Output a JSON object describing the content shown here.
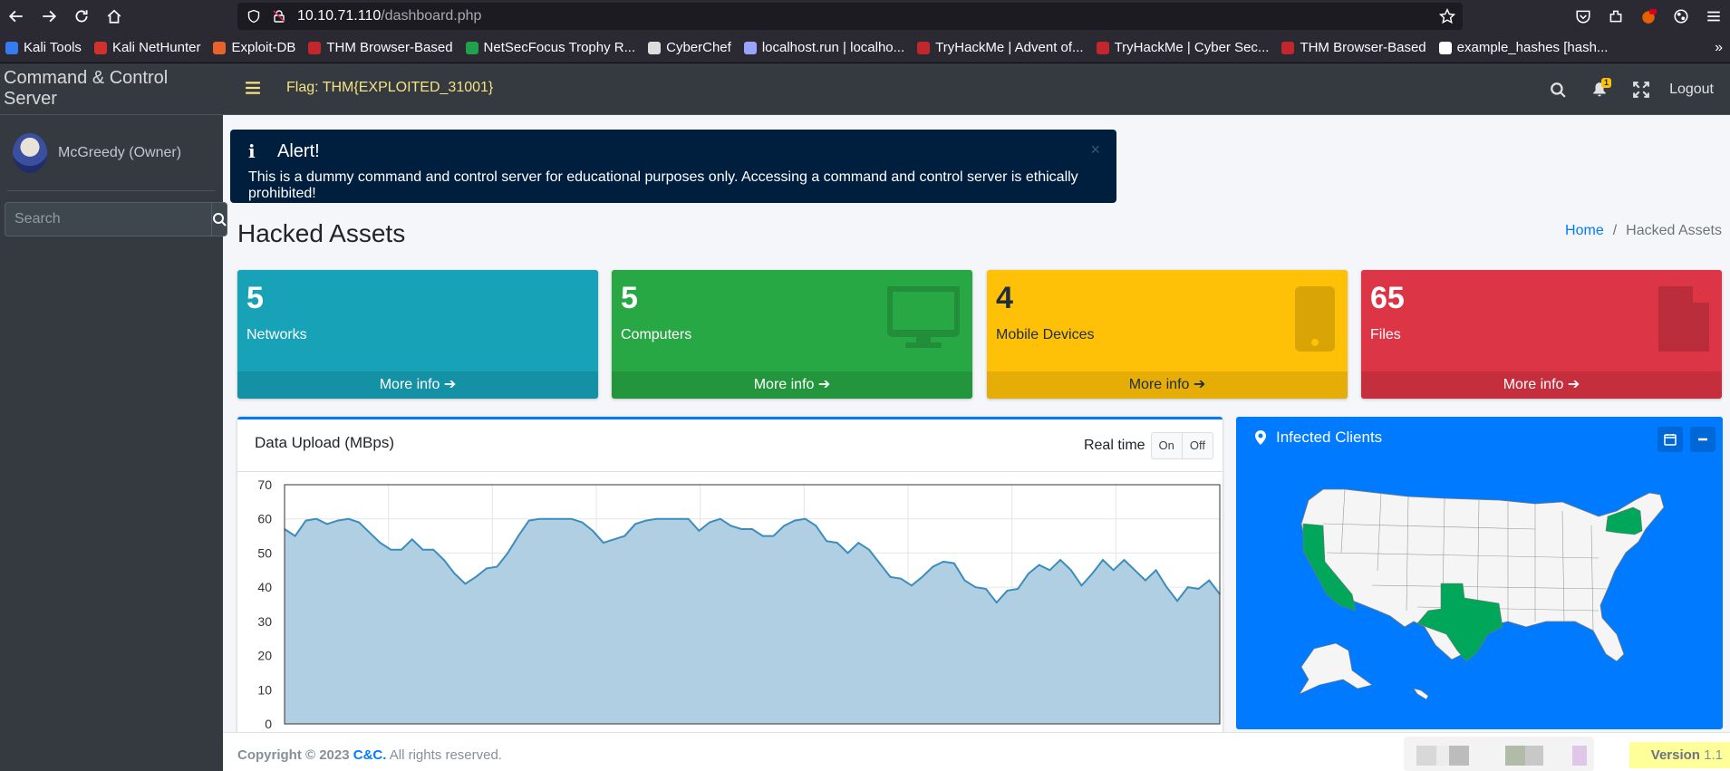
{
  "browser": {
    "url_host": "10.10.71.110",
    "url_path": "/dashboard.php",
    "bookmarks": [
      {
        "label": "Kali Tools",
        "color": "#367bf0"
      },
      {
        "label": "Kali NetHunter",
        "color": "#d0312d"
      },
      {
        "label": "Exploit-DB",
        "color": "#e8622c"
      },
      {
        "label": "THM Browser-Based",
        "color": "#c1272d"
      },
      {
        "label": "NetSecFocus Trophy R...",
        "color": "#22a04b"
      },
      {
        "label": "CyberChef",
        "color": "#dddddd"
      },
      {
        "label": "localhost.run | localho...",
        "color": "#9aa4ff"
      },
      {
        "label": "TryHackMe | Advent of...",
        "color": "#c1272d"
      },
      {
        "label": "TryHackMe | Cyber Sec...",
        "color": "#c1272d"
      },
      {
        "label": "THM Browser-Based",
        "color": "#c1272d"
      },
      {
        "label": "example_hashes [hash...",
        "color": "#ffffff"
      }
    ]
  },
  "sidebar": {
    "brand": "Command & Control Server",
    "user": "McGreedy (Owner)",
    "search_placeholder": "Search"
  },
  "navbar": {
    "flag": "Flag: THM{EXPLOITED_31001}",
    "notification_count": "1",
    "logout": "Logout"
  },
  "alert": {
    "title": "Alert!",
    "message": "This is a dummy command and control server for educational purposes only. Accessing a command and control server is ethically prohibited!"
  },
  "page": {
    "title": "Hacked Assets",
    "breadcrumb_home": "Home",
    "breadcrumb_current": "Hacked Assets"
  },
  "stats": [
    {
      "value": "5",
      "label": "Networks",
      "more": "More info"
    },
    {
      "value": "5",
      "label": "Computers",
      "more": "More info"
    },
    {
      "value": "4",
      "label": "Mobile Devices",
      "more": "More info"
    },
    {
      "value": "65",
      "label": "Files",
      "more": "More info"
    }
  ],
  "upload_card": {
    "title": "Data Upload (MBps)",
    "realtime_label": "Real time",
    "on_label": "On",
    "off_label": "Off"
  },
  "map_card": {
    "title": "Infected Clients"
  },
  "footer": {
    "copyright_prefix": "Copyright © 2023 ",
    "brand": "C&C.",
    "rights": " All rights reserved.",
    "version_label": "Version",
    "version_value": " 1.1"
  },
  "chart_data": {
    "type": "area",
    "title": "",
    "ylim": [
      0,
      70
    ],
    "yticks": [
      0,
      10,
      20,
      30,
      40,
      50,
      60,
      70
    ],
    "grid": true,
    "color": "#3c8dbc",
    "fill": "#b0cfe3",
    "values": [
      57,
      55,
      59.5,
      60,
      58.5,
      59.5,
      60,
      59,
      56,
      53,
      51,
      51,
      54,
      51,
      51,
      48,
      44,
      41,
      43,
      45.5,
      46,
      50,
      55,
      59.5,
      60,
      60,
      60,
      60,
      59,
      56.5,
      53,
      54,
      55,
      58.5,
      59.5,
      60,
      60,
      60,
      60,
      56.5,
      59,
      60,
      58,
      57,
      57,
      55,
      55,
      58,
      59.5,
      60,
      58,
      53.5,
      53,
      50,
      53,
      51,
      47,
      43,
      42.5,
      40.5,
      43,
      46,
      47.5,
      47,
      42,
      40,
      39.5,
      35.5,
      39,
      39.5,
      44,
      46.5,
      45,
      48,
      45,
      40.5,
      44,
      48,
      45,
      48,
      45,
      42,
      45,
      40,
      36,
      40,
      39.5,
      42,
      38
    ]
  }
}
